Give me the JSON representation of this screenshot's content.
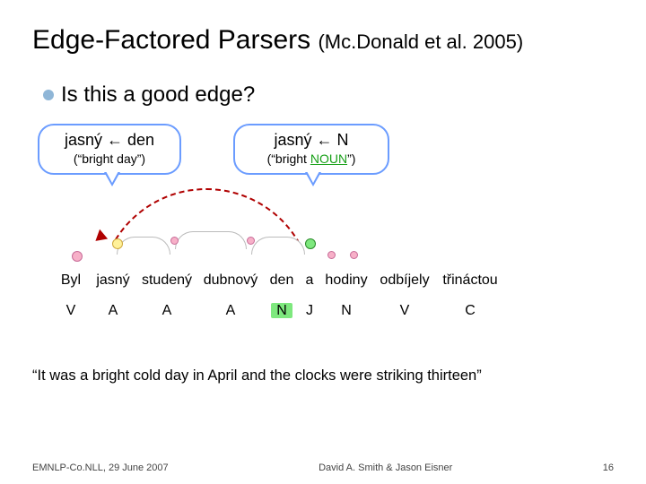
{
  "title_main": "Edge-Factored Parsers ",
  "title_citation": "(Mc.Donald et al. 2005)",
  "bullet": "Is this a good edge?",
  "bubble_left": {
    "main": "jasný ← den",
    "sub": "(“bright day”)"
  },
  "bubble_right": {
    "main": "jasný ← N",
    "sub_prefix": "(“bright ",
    "sub_noun": "NOUN",
    "sub_suffix": "”)"
  },
  "words": [
    "Byl",
    "jasný",
    "studený",
    "dubnový",
    "den",
    "a",
    "hodiny",
    "odbíjely",
    "třináctou"
  ],
  "tags": [
    "V",
    "A",
    "A",
    "A",
    "N",
    "J",
    "N",
    "V",
    "C"
  ],
  "translation": "“It was a bright cold day in April and the clocks were striking thirteen”",
  "footer_left": "EMNLP-Co.NLL, 29 June 2007",
  "footer_center": "David A. Smith & Jason Eisner",
  "footer_right": "16"
}
